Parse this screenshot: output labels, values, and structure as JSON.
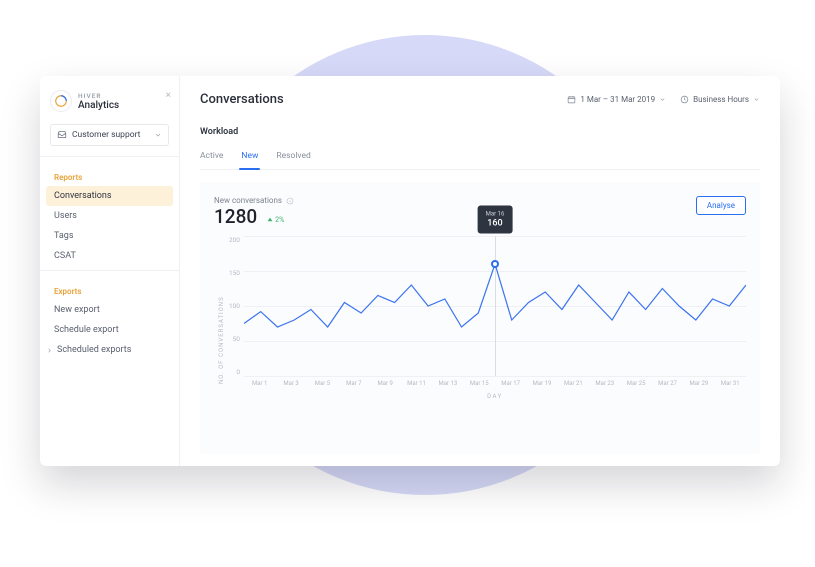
{
  "brand": {
    "small": "HIVER",
    "name": "Analytics"
  },
  "mailbox_select": {
    "label": "Customer support"
  },
  "sidebar": {
    "reports_heading": "Reports",
    "reports": [
      {
        "label": "Conversations",
        "active": true
      },
      {
        "label": "Users"
      },
      {
        "label": "Tags"
      },
      {
        "label": "CSAT"
      }
    ],
    "exports_heading": "Exports",
    "exports": [
      {
        "label": "New export"
      },
      {
        "label": "Schedule export"
      },
      {
        "label": "Scheduled exports",
        "expand": true
      }
    ]
  },
  "header": {
    "title": "Conversations",
    "date_range": "1 Mar – 31 Mar 2019",
    "hours": "Business Hours"
  },
  "section": {
    "label": "Workload"
  },
  "tabs": [
    {
      "label": "Active"
    },
    {
      "label": "New",
      "active": true
    },
    {
      "label": "Resolved"
    }
  ],
  "card": {
    "metric_label": "New conversations",
    "metric_value": "1280",
    "delta": "2%",
    "analyse": "Analyse"
  },
  "tooltip": {
    "date": "Mar 16",
    "value": "160"
  },
  "axes": {
    "ylabel": "NO. OF CONVERSATIONS",
    "xlabel": "DAY",
    "yticks": [
      "200",
      "150",
      "100",
      "50",
      "0"
    ],
    "xticks": [
      "Mar 1",
      "Mar 3",
      "Mar 5",
      "Mar 7",
      "Mar 9",
      "Mar 11",
      "Mar 13",
      "Mar 15",
      "Mar 17",
      "Mar 19",
      "Mar 21",
      "Mar 23",
      "Mar 25",
      "Mar 27",
      "Mar 29",
      "Mar 31"
    ]
  },
  "chart_data": {
    "type": "line",
    "title": "New conversations",
    "xlabel": "DAY",
    "ylabel": "NO. OF CONVERSATIONS",
    "ylim": [
      0,
      200
    ],
    "x": [
      "Mar 1",
      "Mar 2",
      "Mar 3",
      "Mar 4",
      "Mar 5",
      "Mar 6",
      "Mar 7",
      "Mar 8",
      "Mar 9",
      "Mar 10",
      "Mar 11",
      "Mar 12",
      "Mar 13",
      "Mar 14",
      "Mar 15",
      "Mar 16",
      "Mar 17",
      "Mar 18",
      "Mar 19",
      "Mar 20",
      "Mar 21",
      "Mar 22",
      "Mar 23",
      "Mar 24",
      "Mar 25",
      "Mar 26",
      "Mar 27",
      "Mar 28",
      "Mar 29",
      "Mar 30",
      "Mar 31"
    ],
    "values": [
      75,
      92,
      70,
      80,
      95,
      70,
      105,
      90,
      115,
      105,
      130,
      100,
      110,
      70,
      90,
      160,
      80,
      105,
      120,
      95,
      130,
      105,
      80,
      120,
      95,
      125,
      100,
      80,
      110,
      100,
      130
    ],
    "highlight": {
      "x": "Mar 16",
      "value": 160
    }
  }
}
